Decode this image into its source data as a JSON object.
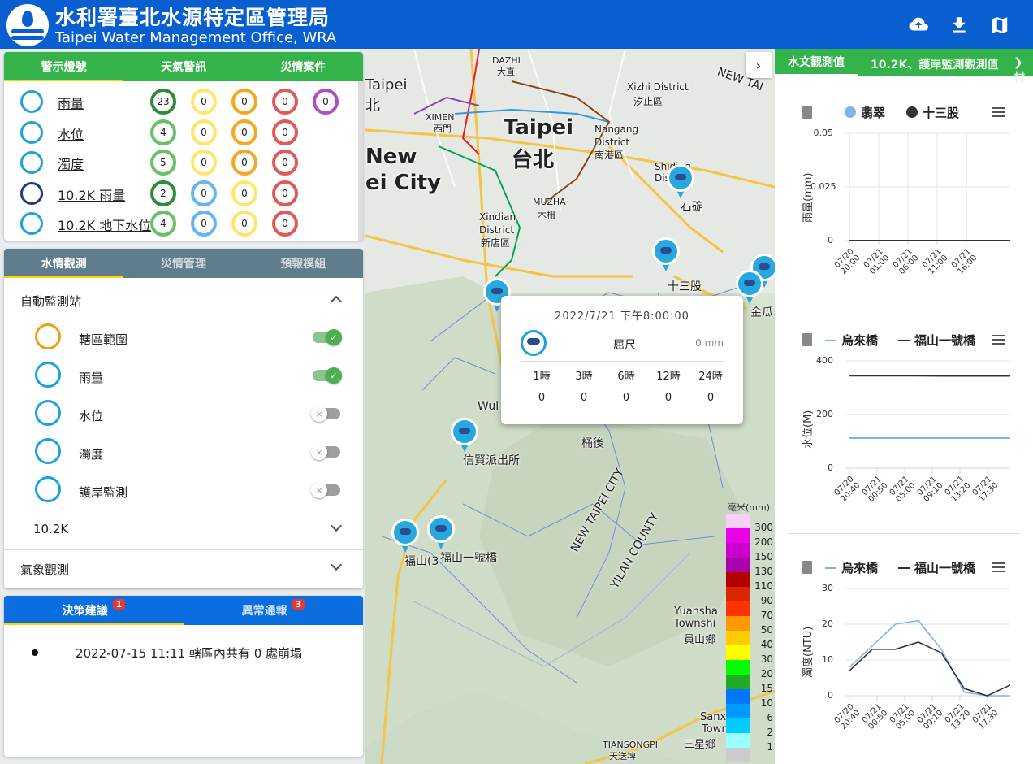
{
  "header": {
    "title": "水利署臺北水源特定區管理局",
    "subtitle": "Taipei Water Management Office, WRA"
  },
  "alert_panel": {
    "tabs": [
      "警示燈號",
      "天氣警訊",
      "災情案件"
    ],
    "rows": [
      {
        "label": "雨量",
        "counts": [
          "23",
          "0",
          "0",
          "0",
          "0"
        ],
        "colors": [
          "#2e8b3a",
          "#ffe66b",
          "#f5a623",
          "#e05a5a",
          "#b04fc0"
        ]
      },
      {
        "label": "水位",
        "counts": [
          "4",
          "0",
          "0",
          "0"
        ],
        "colors": [
          "#6abf69",
          "#ffe66b",
          "#f5a623",
          "#e05a5a"
        ]
      },
      {
        "label": "濁度",
        "counts": [
          "5",
          "0",
          "0",
          "0"
        ],
        "colors": [
          "#6abf69",
          "#ffe66b",
          "#f5a623",
          "#e05a5a"
        ]
      },
      {
        "label": "10.2K 雨量",
        "counts": [
          "2",
          "0",
          "0",
          "0"
        ],
        "colors": [
          "#2e8b3a",
          "#64b5f6",
          "#ffe66b",
          "#e05a5a"
        ]
      },
      {
        "label": "10.2K 地下水位",
        "counts": [
          "4",
          "0",
          "0",
          "0"
        ],
        "colors": [
          "#6abf69",
          "#64b5f6",
          "#ffe66b",
          "#e05a5a"
        ]
      }
    ]
  },
  "obs_panel": {
    "tabs": [
      "水情觀測",
      "災情管理",
      "預報模組"
    ],
    "section_auto": "自動監測站",
    "layers": [
      {
        "label": "轄區範圍",
        "on": true
      },
      {
        "label": "雨量",
        "on": true
      },
      {
        "label": "水位",
        "on": false
      },
      {
        "label": "濁度",
        "on": false
      },
      {
        "label": "護岸監測",
        "on": false
      }
    ],
    "section_102k": "10.2K",
    "section_weather": "氣象觀測"
  },
  "notice_panel": {
    "tabs": [
      {
        "label": "決策建議",
        "badge": "1"
      },
      {
        "label": "異常通報",
        "badge": "3"
      }
    ],
    "items": [
      "2022-07-15 11:11 轄區內共有 0 處崩塌"
    ]
  },
  "map": {
    "labels": [
      "石碇",
      "十三股",
      "金瓜",
      "信賢派出所",
      "桶後",
      "福山(3",
      "福山一號橋",
      "Taipei",
      "台北",
      "New",
      "ei City",
      "Xindian",
      "District",
      "新店區",
      "Nangang",
      "District",
      "南港區",
      "Xizhi District",
      "汐止區",
      "DAZHI",
      "大直",
      "XIMEN",
      "西門",
      "MUZHA",
      "木柵",
      "Shiding",
      "Distr",
      "NEW TAIPEI CITY",
      "YILAN COUNTY",
      "Yuansha",
      "Townshi",
      "員山鄉",
      "Sanxing",
      "Townshi",
      "三星鄉",
      "TIANSONGPI",
      "天送埤",
      "Wul",
      "NEW TAI",
      "Taipei",
      "北"
    ],
    "popup": {
      "time": "2022/7/21 下午8:00:00",
      "station": "屈尺",
      "value": "0 mm",
      "headers": [
        "1時",
        "3時",
        "6時",
        "12時",
        "24時"
      ],
      "values": [
        "0",
        "0",
        "0",
        "0",
        "0"
      ]
    },
    "legend": {
      "unit": "毫米(mm)",
      "levels": [
        "300",
        "200",
        "150",
        "130",
        "110",
        "90",
        "70",
        "50",
        "40",
        "30",
        "20",
        "15",
        "10",
        "6",
        "2",
        "1"
      ],
      "colors": [
        "#fe00fe",
        "#ea00ea",
        "#cc00cc",
        "#aa00aa",
        "#b30000",
        "#d92600",
        "#ff3300",
        "#ff9900",
        "#ffcc00",
        "#ffff00",
        "#00ff00",
        "#22aa22",
        "#0077ff",
        "#0099ff",
        "#00ccff",
        "#99ffff",
        "#cccccc"
      ]
    }
  },
  "right_panel": {
    "tabs": [
      "水文觀測值",
      "10.2K、護岸監測觀測值",
      "村"
    ],
    "charts": [
      {
        "legend": [
          "翡翠",
          "十三股"
        ],
        "ylabel": "雨量(mm)",
        "yticks": [
          "0.05",
          "0.025",
          "0"
        ],
        "xticks": [
          "07/20 20:00",
          "07/21 01:00",
          "07/21 06:00",
          "07/21 11:00",
          "07/21 16:00"
        ]
      },
      {
        "legend": [
          "烏來橋",
          "福山一號橋"
        ],
        "ylabel": "水位(M)",
        "yticks": [
          "400",
          "200",
          "0"
        ],
        "xticks": [
          "07/20 20:40",
          "07/21 00:50",
          "07/21 05:00",
          "07/21 09:10",
          "07/21 13:20",
          "07/21 17:30"
        ]
      },
      {
        "legend": [
          "烏來橋",
          "福山一號橋"
        ],
        "ylabel": "濁度(NTU)",
        "yticks": [
          "30",
          "20",
          "10",
          "0"
        ],
        "xticks": [
          "07/20 20:40",
          "07/21 00:50",
          "07/21 05:00",
          "07/21 09:10",
          "07/21 13:20",
          "07/21 17:30"
        ]
      }
    ]
  },
  "chart_data": [
    {
      "type": "line",
      "ylabel": "雨量(mm)",
      "ylim": [
        0,
        0.05
      ],
      "x": [
        "07/20 20:00",
        "07/21 01:00",
        "07/21 06:00",
        "07/21 11:00",
        "07/21 16:00"
      ],
      "series": [
        {
          "name": "翡翠",
          "values": [
            0,
            0,
            0,
            0,
            0
          ]
        },
        {
          "name": "十三股",
          "values": [
            0,
            0,
            0,
            0,
            0
          ]
        }
      ]
    },
    {
      "type": "line",
      "ylabel": "水位(M)",
      "ylim": [
        0,
        400
      ],
      "x": [
        "07/20 20:40",
        "07/21 00:50",
        "07/21 05:00",
        "07/21 09:10",
        "07/21 13:20",
        "07/21 17:30"
      ],
      "series": [
        {
          "name": "烏來橋",
          "values": [
            112,
            112,
            112,
            112,
            112,
            112
          ]
        },
        {
          "name": "福山一號橋",
          "values": [
            345,
            345,
            345,
            344,
            344,
            344
          ]
        }
      ]
    },
    {
      "type": "line",
      "ylabel": "濁度(NTU)",
      "ylim": [
        0,
        30
      ],
      "x": [
        "07/20 20:40",
        "07/21 00:50",
        "07/21 05:00",
        "07/21 09:10",
        "07/21 13:20",
        "07/21 17:30"
      ],
      "series": [
        {
          "name": "烏來橋",
          "values": [
            8,
            14,
            20,
            21,
            13,
            1,
            0,
            0
          ]
        },
        {
          "name": "福山一號橋",
          "values": [
            7,
            13,
            13,
            15,
            12,
            2,
            0,
            3
          ]
        }
      ]
    }
  ]
}
